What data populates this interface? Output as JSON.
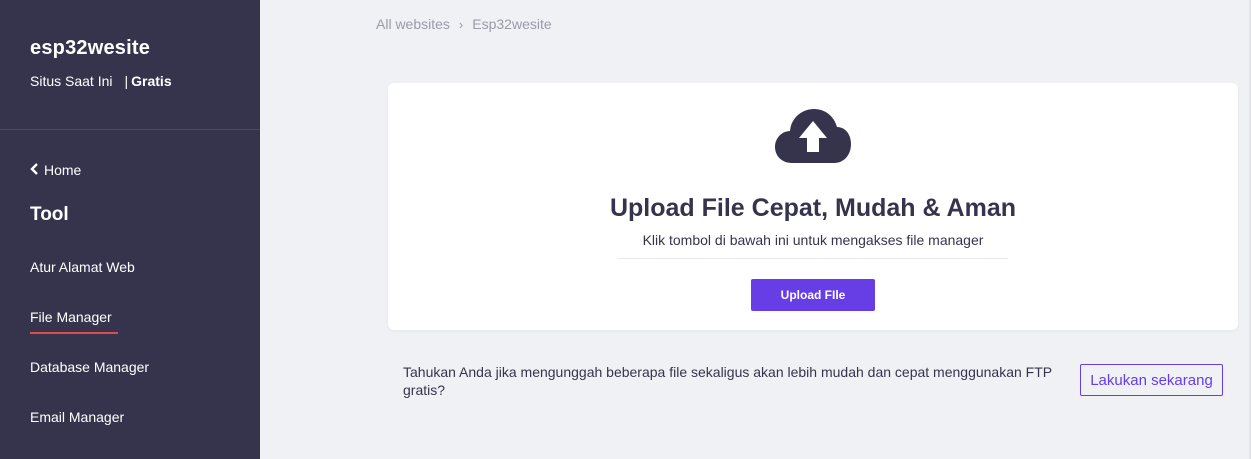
{
  "sidebar": {
    "site_name": "esp32wesite",
    "site_status": "Situs Saat Ini",
    "plan_separator": "|",
    "plan": "Gratis",
    "home_label": "Home",
    "home_icon": "chevron-left-icon",
    "section_title": "Tool",
    "items": [
      {
        "label": "Atur Alamat Web",
        "active": false
      },
      {
        "label": "File Manager",
        "active": true
      },
      {
        "label": "Database Manager",
        "active": false
      },
      {
        "label": "Email Manager",
        "active": false
      }
    ]
  },
  "breadcrumb": {
    "root": "All websites",
    "separator": "›",
    "current": "Esp32wesite"
  },
  "card": {
    "icon": "cloud-upload-icon",
    "title": "Upload File Cepat, Mudah & Aman",
    "subtitle": "Klik tombol di bawah ini untuk mengakses file manager",
    "button_label": "Upload FIle"
  },
  "ftp": {
    "text": "Tahukan Anda jika mengunggah beberapa file sekaligus akan lebih mudah dan cepat menggunakan FTP gratis?",
    "button_label": "Lakukan sekarang"
  },
  "colors": {
    "sidebar_bg": "#36344d",
    "accent": "#673de6",
    "active_underline": "#e5484d",
    "page_bg": "#f0f1f5"
  }
}
